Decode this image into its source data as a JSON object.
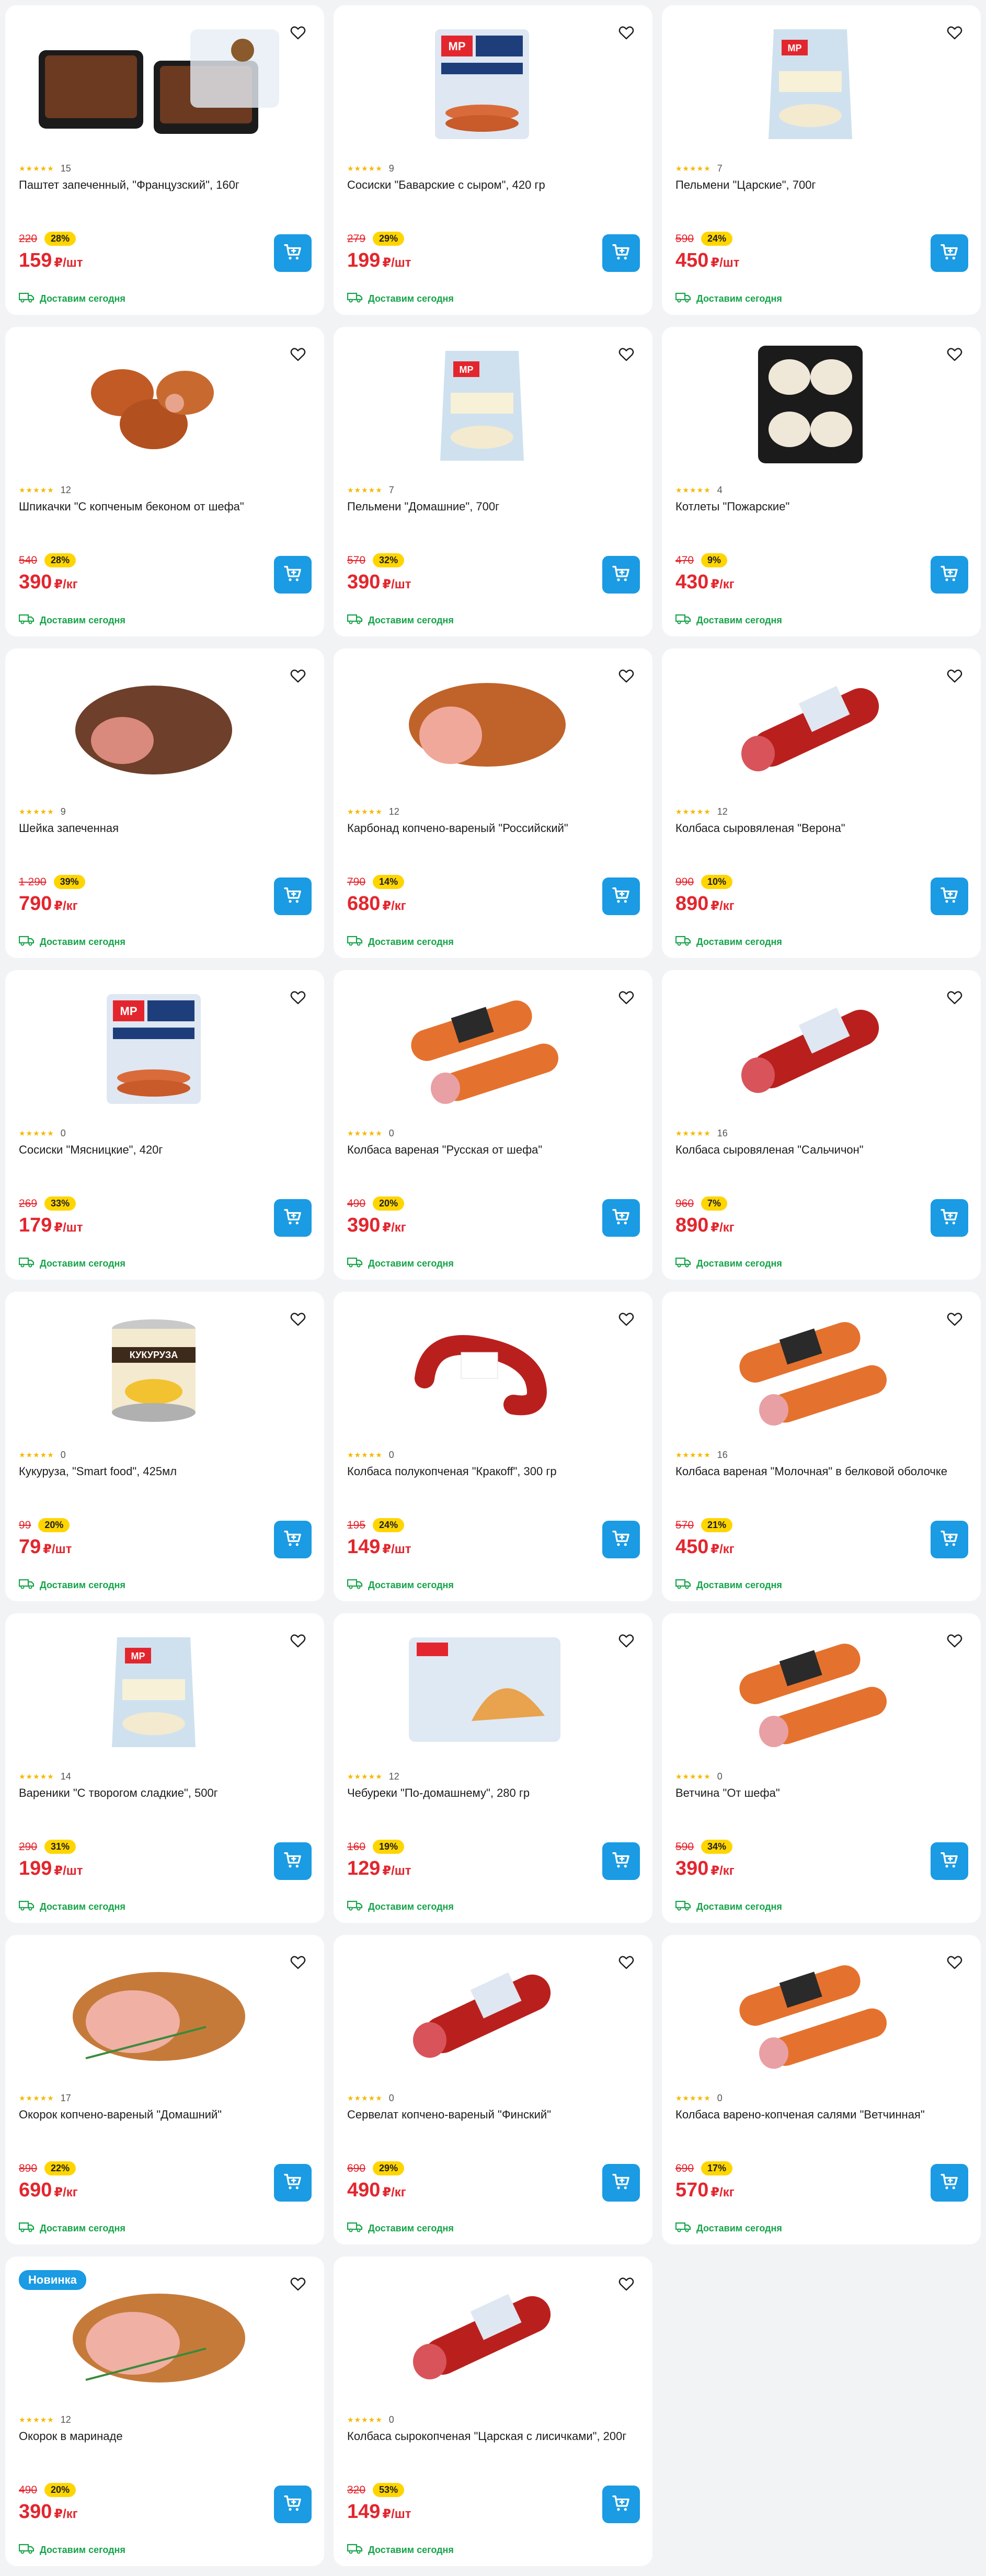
{
  "products": [
    {
      "name": "Паштет запеченный, \"Французский\", 160г",
      "rating_count": "15",
      "old_price": "220",
      "discount": "28%",
      "price": "159",
      "unit": "₽/шт",
      "delivery": "Доставим сегодня",
      "image": "pate-tray"
    },
    {
      "name": "Сосиски \"Баварские с сыром\", 420 гр",
      "rating_count": "9",
      "old_price": "279",
      "discount": "29%",
      "price": "199",
      "unit": "₽/шт",
      "delivery": "Доставим сегодня",
      "image": "sausage-pack"
    },
    {
      "name": "Пельмени \"Царские\", 700г",
      "rating_count": "7",
      "old_price": "590",
      "discount": "24%",
      "price": "450",
      "unit": "₽/шт",
      "delivery": "Доставим сегодня",
      "image": "dumpling-bag"
    },
    {
      "name": "Шпикачки \"С копченым беконом от шефа\"",
      "rating_count": "12",
      "old_price": "540",
      "discount": "28%",
      "price": "390",
      "unit": "₽/кг",
      "delivery": "Доставим сегодня",
      "image": "sausage-link"
    },
    {
      "name": "Пельмени \"Домашние\", 700г",
      "rating_count": "7",
      "old_price": "570",
      "discount": "32%",
      "price": "390",
      "unit": "₽/шт",
      "delivery": "Доставим сегодня",
      "image": "dumpling-bag"
    },
    {
      "name": "Котлеты \"Пожарские\"",
      "rating_count": "4",
      "old_price": "470",
      "discount": "9%",
      "price": "430",
      "unit": "₽/кг",
      "delivery": "Доставим сегодня",
      "image": "cutlet-tray"
    },
    {
      "name": "Шейка запеченная",
      "rating_count": "9",
      "old_price": "1 290",
      "discount": "39%",
      "price": "790",
      "unit": "₽/кг",
      "delivery": "Доставим сегодня",
      "image": "roast-meat"
    },
    {
      "name": "Карбонад копчено-вареный \"Российский\"",
      "rating_count": "12",
      "old_price": "790",
      "discount": "14%",
      "price": "680",
      "unit": "₽/кг",
      "delivery": "Доставим сегодня",
      "image": "smoked-loin"
    },
    {
      "name": "Колбаса сыровяленая \"Верона\"",
      "rating_count": "12",
      "old_price": "990",
      "discount": "10%",
      "price": "890",
      "unit": "₽/кг",
      "delivery": "Доставим сегодня",
      "image": "salami-stick"
    },
    {
      "name": "Сосиски \"Мясницкие\", 420г",
      "rating_count": "0",
      "old_price": "269",
      "discount": "33%",
      "price": "179",
      "unit": "₽/шт",
      "delivery": "Доставим сегодня",
      "image": "sausage-pack"
    },
    {
      "name": "Колбаса вареная \"Русская от шефа\"",
      "rating_count": "0",
      "old_price": "490",
      "discount": "20%",
      "price": "390",
      "unit": "₽/кг",
      "delivery": "Доставим сегодня",
      "image": "boiled-sausage"
    },
    {
      "name": "Колбаса сыровяленая \"Сальчичон\"",
      "rating_count": "16",
      "old_price": "960",
      "discount": "7%",
      "price": "890",
      "unit": "₽/кг",
      "delivery": "Доставим сегодня",
      "image": "salami-stick"
    },
    {
      "name": "Кукуруза, \"Smart food\", 425мл",
      "rating_count": "0",
      "old_price": "99",
      "discount": "20%",
      "price": "79",
      "unit": "₽/шт",
      "delivery": "Доставим сегодня",
      "image": "corn-can"
    },
    {
      "name": "Колбаса полукопченая \"Кракoff\", 300 гр",
      "rating_count": "0",
      "old_price": "195",
      "discount": "24%",
      "price": "149",
      "unit": "₽/шт",
      "delivery": "Доставим сегодня",
      "image": "ring-sausage"
    },
    {
      "name": "Колбаса вареная \"Молочная\" в белковой оболочке",
      "rating_count": "16",
      "old_price": "570",
      "discount": "21%",
      "price": "450",
      "unit": "₽/кг",
      "delivery": "Доставим сегодня",
      "image": "boiled-sausage"
    },
    {
      "name": "Вареники \"С творогом сладкие\", 500г",
      "rating_count": "14",
      "old_price": "290",
      "discount": "31%",
      "price": "199",
      "unit": "₽/шт",
      "delivery": "Доставим сегодня",
      "image": "dumpling-bag"
    },
    {
      "name": "Чебуреки \"По-домашнему\", 280 гр",
      "rating_count": "12",
      "old_price": "160",
      "discount": "19%",
      "price": "129",
      "unit": "₽/шт",
      "delivery": "Доставим сегодня",
      "image": "cheburek-pack"
    },
    {
      "name": "Ветчина \"От шефа\"",
      "rating_count": "0",
      "old_price": "590",
      "discount": "34%",
      "price": "390",
      "unit": "₽/кг",
      "delivery": "Доставим сегодня",
      "image": "boiled-sausage"
    },
    {
      "name": "Окорок копчено-вареный \"Домашний\"",
      "rating_count": "17",
      "old_price": "890",
      "discount": "22%",
      "price": "690",
      "unit": "₽/кг",
      "delivery": "Доставим сегодня",
      "image": "ham-roast"
    },
    {
      "name": "Сервелат копчено-вареный \"Финский\"",
      "rating_count": "0",
      "old_price": "690",
      "discount": "29%",
      "price": "490",
      "unit": "₽/кг",
      "delivery": "Доставим сегодня",
      "image": "salami-stick"
    },
    {
      "name": "Колбаса варено-копченая салями \"Ветчинная\"",
      "rating_count": "0",
      "old_price": "690",
      "discount": "17%",
      "price": "570",
      "unit": "₽/кг",
      "delivery": "Доставим сегодня",
      "image": "boiled-sausage"
    },
    {
      "name": "Окорок в маринаде",
      "rating_count": "12",
      "old_price": "490",
      "discount": "20%",
      "price": "390",
      "unit": "₽/кг",
      "delivery": "Доставим сегодня",
      "image": "ham-roast",
      "badge": "Новинка"
    },
    {
      "name": "Колбаса сырокопченая \"Царская с лисичками\", 200г",
      "rating_count": "0",
      "old_price": "320",
      "discount": "53%",
      "price": "149",
      "unit": "₽/шт",
      "delivery": "Доставим сегодня",
      "image": "salami-stick"
    }
  ],
  "colors": {
    "accent": "#1a9be3",
    "price": "#e3262e",
    "discount_badge": "#ffd500",
    "delivery": "#16a34a",
    "stars": "#f5b800"
  },
  "icons": {
    "favorite": "heart-icon",
    "cart": "cart-icon",
    "delivery": "truck-icon",
    "rating": "star-icon"
  }
}
